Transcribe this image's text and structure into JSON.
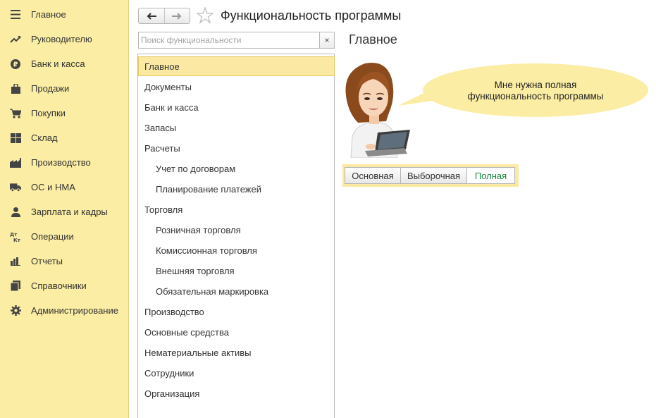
{
  "sidebar": {
    "items": [
      {
        "label": "Главное",
        "icon": "menu-icon"
      },
      {
        "label": "Руководителю",
        "icon": "trend-icon"
      },
      {
        "label": "Банк и касса",
        "icon": "ruble-icon"
      },
      {
        "label": "Продажи",
        "icon": "bag-icon"
      },
      {
        "label": "Покупки",
        "icon": "cart-icon"
      },
      {
        "label": "Склад",
        "icon": "warehouse-icon"
      },
      {
        "label": "Производство",
        "icon": "factory-icon"
      },
      {
        "label": "ОС и НМА",
        "icon": "truck-icon"
      },
      {
        "label": "Зарплата и кадры",
        "icon": "person-icon"
      },
      {
        "label": "Операции",
        "icon": "dt-kt-icon",
        "icon_text": "Дт Кт"
      },
      {
        "label": "Отчеты",
        "icon": "bar-chart-icon"
      },
      {
        "label": "Справочники",
        "icon": "books-icon"
      },
      {
        "label": "Администрирование",
        "icon": "gear-icon"
      }
    ]
  },
  "header": {
    "title": "Функциональность программы"
  },
  "search": {
    "placeholder": "Поиск функциональности",
    "clear_label": "×"
  },
  "tree": {
    "items": [
      {
        "label": "Главное",
        "level": 0,
        "selected": true
      },
      {
        "label": "Документы",
        "level": 0
      },
      {
        "label": "Банк и касса",
        "level": 0
      },
      {
        "label": "Запасы",
        "level": 0
      },
      {
        "label": "Расчеты",
        "level": 0
      },
      {
        "label": "Учет по договорам",
        "level": 1
      },
      {
        "label": "Планирование платежей",
        "level": 1
      },
      {
        "label": "Торговля",
        "level": 0
      },
      {
        "label": "Розничная торговля",
        "level": 1
      },
      {
        "label": "Комиссионная торговля",
        "level": 1
      },
      {
        "label": "Внешняя торговля",
        "level": 1
      },
      {
        "label": "Обязательная маркировка",
        "level": 1
      },
      {
        "label": "Производство",
        "level": 0
      },
      {
        "label": "Основные средства",
        "level": 0
      },
      {
        "label": "Нематериальные активы",
        "level": 0
      },
      {
        "label": "Сотрудники",
        "level": 0
      },
      {
        "label": "Организация",
        "level": 0
      }
    ]
  },
  "main": {
    "section_title": "Главное",
    "bubble_line1": "Мне нужна полная",
    "bubble_line2": "функциональность программы",
    "modes": [
      "Основная",
      "Выборочная",
      "Полная"
    ],
    "active_mode": "Полная"
  },
  "colors": {
    "sidebar_bg": "#fbeda4",
    "selection": "#fbe9a3",
    "active_mode_text": "#1a8a3e"
  }
}
